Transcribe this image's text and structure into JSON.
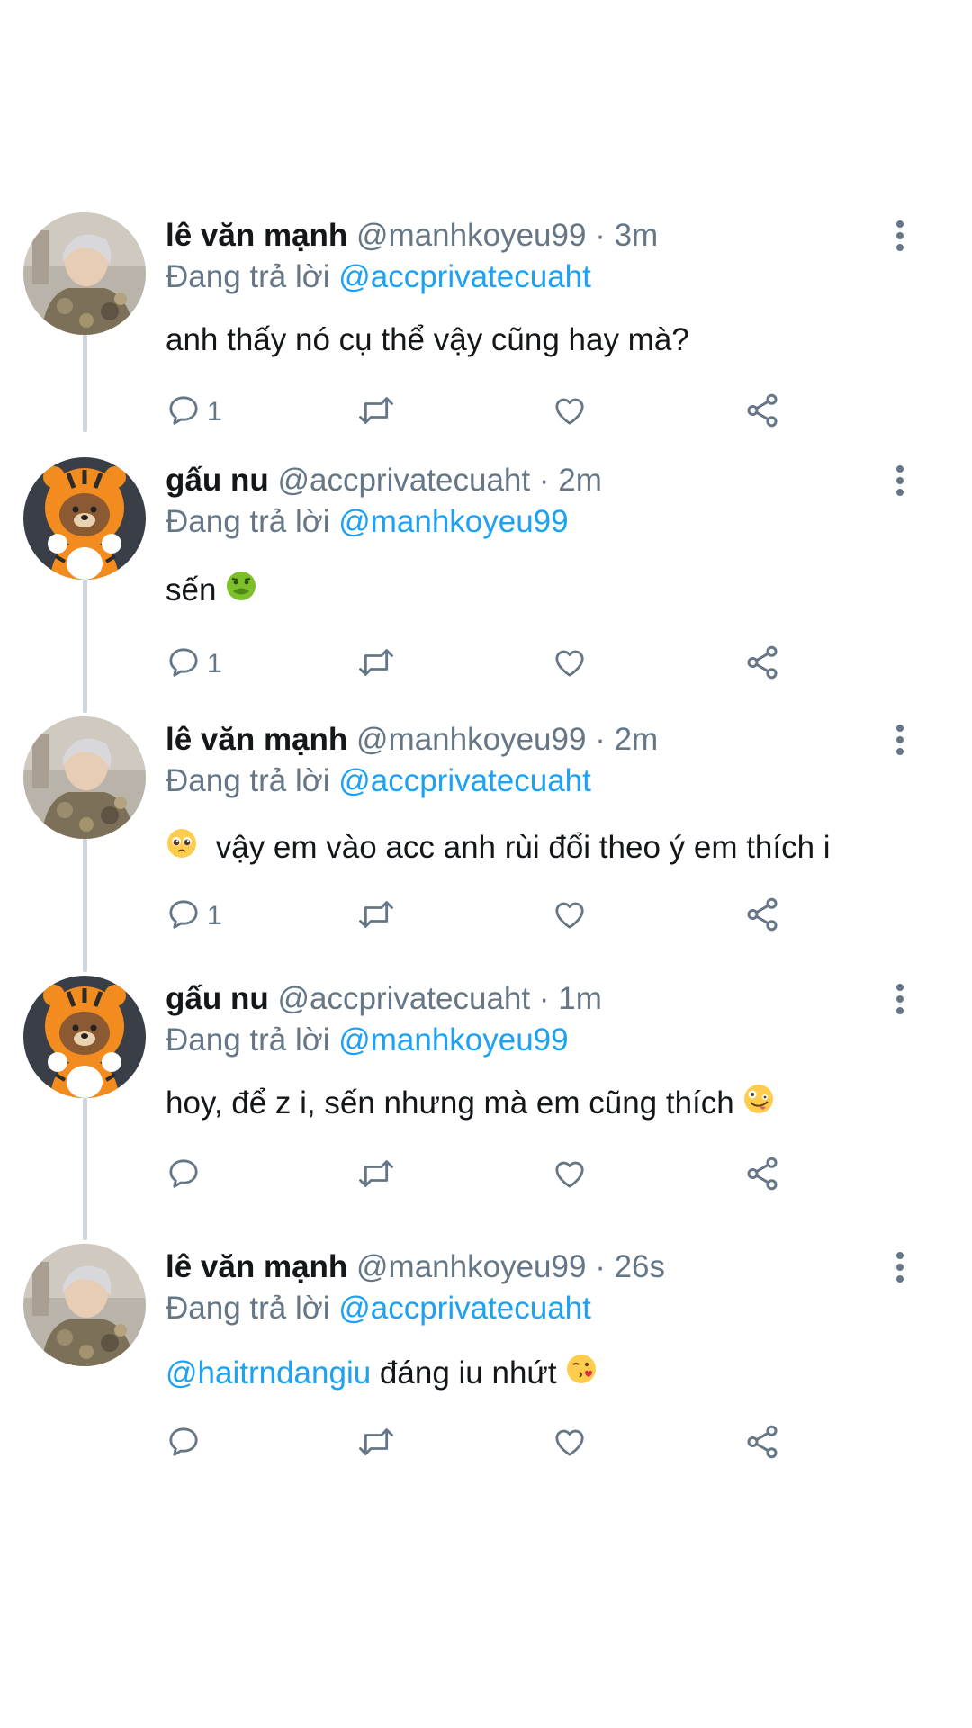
{
  "thread": {
    "tweets": [
      {
        "author": "lê văn mạnh",
        "handle": "@manhkoyeu99",
        "dot": "·",
        "time": "3m",
        "reply_prefix": "Đang trả lời",
        "reply_to": "@accprivatecuaht",
        "avatar": "person-photo",
        "text": "anh thấy nó cụ thể vậy cũng hay mà?",
        "reply_count": "1"
      },
      {
        "author": "gấu nu",
        "handle": "@accprivatecuaht",
        "dot": "·",
        "time": "2m",
        "reply_prefix": "Đang trả lời",
        "reply_to": "@manhkoyeu99",
        "avatar": "tiger-bear",
        "text": "sến",
        "emoji": "nauseated-face-emoji",
        "reply_count": "1"
      },
      {
        "author": "lê văn mạnh",
        "handle": "@manhkoyeu99",
        "dot": "·",
        "time": "2m",
        "reply_prefix": "Đang trả lời",
        "reply_to": "@accprivatecuaht",
        "avatar": "person-photo",
        "emoji": "pleading-face-emoji",
        "text": "vậy em vào acc anh rùi đổi theo ý em thích i",
        "reply_count": "1"
      },
      {
        "author": "gấu nu",
        "handle": "@accprivatecuaht",
        "dot": "·",
        "time": "1m",
        "reply_prefix": "Đang trả lời",
        "reply_to": "@manhkoyeu99",
        "avatar": "tiger-bear",
        "text": "hoy, để z i, sến nhưng mà em cũng thích",
        "emoji": "zany-face-emoji",
        "reply_count": ""
      },
      {
        "author": "lê văn mạnh",
        "handle": "@manhkoyeu99",
        "dot": "·",
        "time": "26s",
        "reply_prefix": "Đang trả lời",
        "reply_to": "@accprivatecuaht",
        "avatar": "person-photo",
        "mention": "@haitrndangiu",
        "text": "đáng iu nhứt",
        "emoji": "kissing-heart-emoji",
        "reply_count": ""
      }
    ]
  },
  "colors": {
    "link": "#1da1f2",
    "secondary_text": "#657786",
    "primary_text": "#14171a",
    "thread_line": "#ccd6dd",
    "icon": "#657786"
  },
  "icons": {
    "reply": "reply-icon",
    "retweet": "retweet-icon",
    "like": "like-icon",
    "share": "share-icon",
    "more": "more-vertical-icon"
  }
}
